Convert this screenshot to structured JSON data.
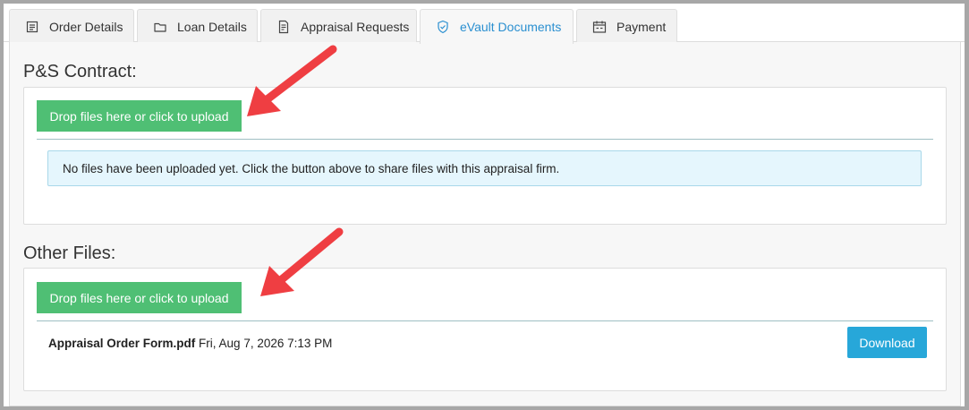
{
  "tabs": [
    {
      "label": "Order Details",
      "icon": "list-icon",
      "active": false
    },
    {
      "label": "Loan Details",
      "icon": "folder-icon",
      "active": false
    },
    {
      "label": "Appraisal Requests",
      "icon": "document-icon",
      "active": false
    },
    {
      "label": "eVault Documents",
      "icon": "shield-icon",
      "active": true
    },
    {
      "label": "Payment",
      "icon": "calendar-icon",
      "active": false
    }
  ],
  "sections": {
    "ps_contract": {
      "title": "P&S Contract:",
      "upload_label": "Drop files here or click to upload",
      "empty_message": "No files have been uploaded yet. Click the button above to share files with this appraisal firm."
    },
    "other_files": {
      "title": "Other Files:",
      "upload_label": "Drop files here or click to upload",
      "files": [
        {
          "name": "Appraisal Order Form.pdf",
          "date": "Fri, Aug 7, 2026 7:13 PM",
          "action": "Download"
        }
      ]
    }
  },
  "colors": {
    "upload_button": "#4fbf74",
    "download_button": "#27a7d9",
    "active_tab_text": "#2a8fd0",
    "annotation_arrow": "#ef3e42"
  }
}
